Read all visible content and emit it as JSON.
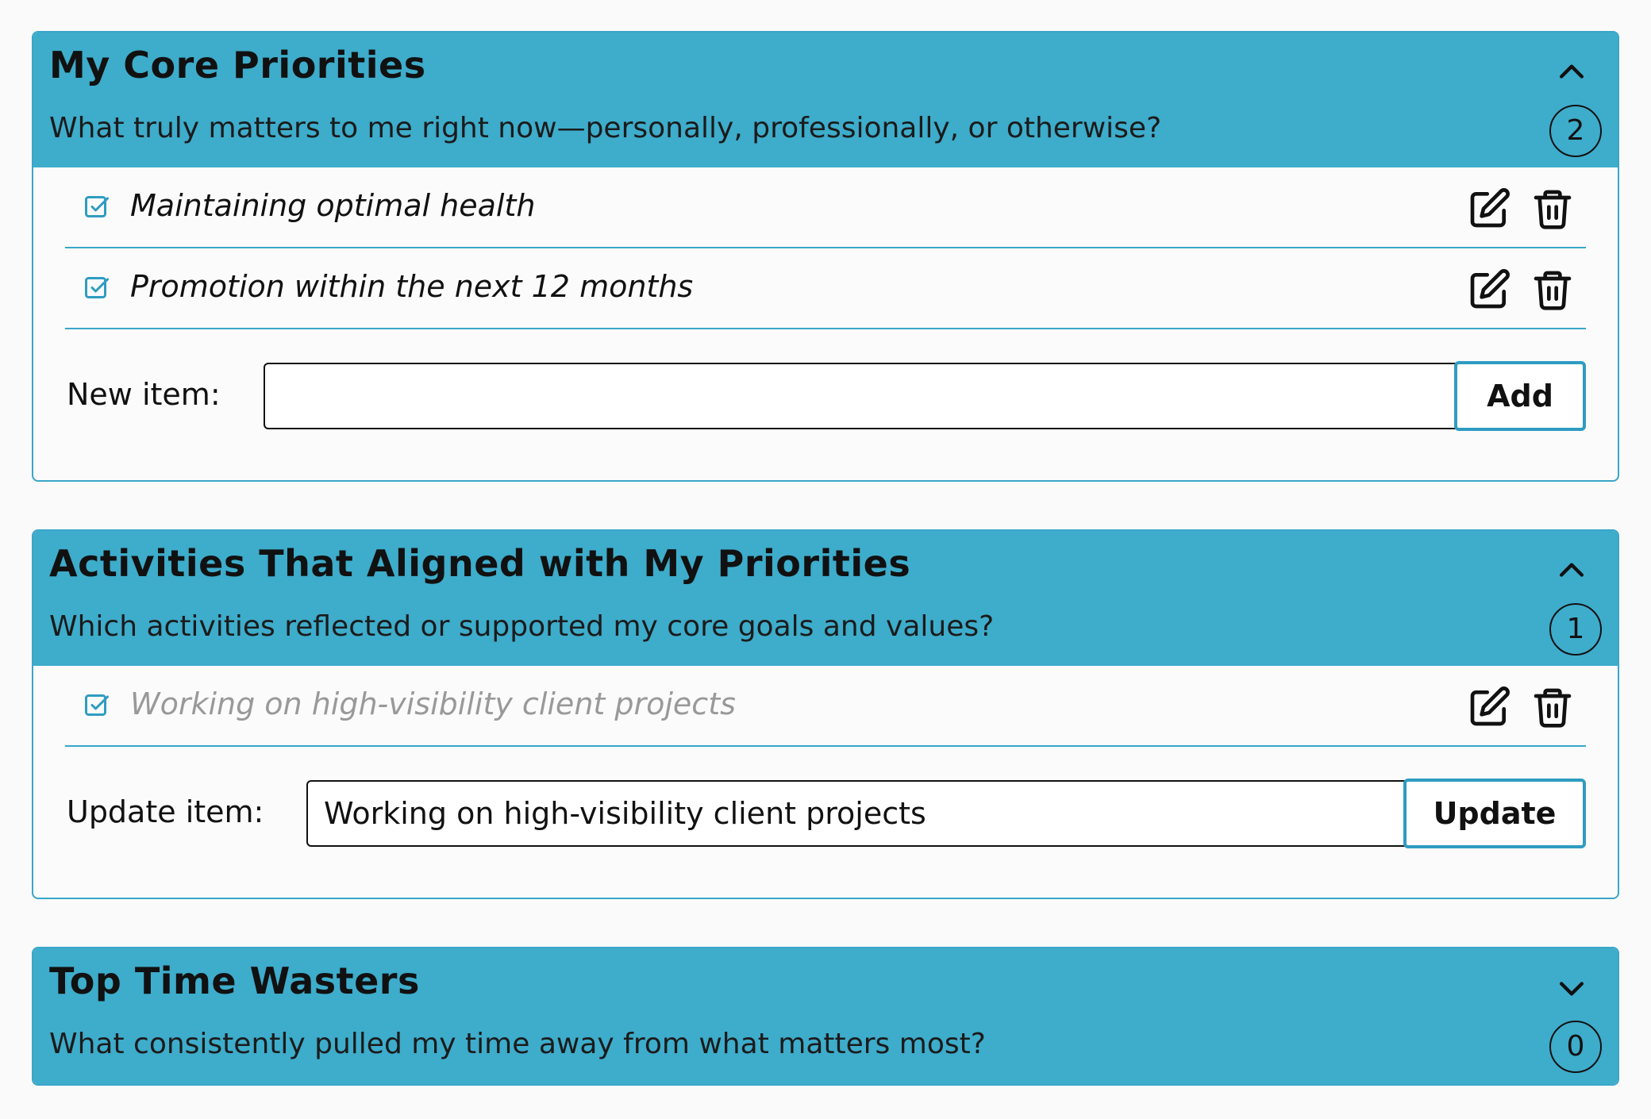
{
  "sections": [
    {
      "title": "My Core Priorities",
      "subtitle": "What truly matters to me right now—personally, professionally, or otherwise?",
      "count": "2",
      "expanded": true,
      "items": [
        {
          "text": "Maintaining optimal health",
          "muted": false
        },
        {
          "text": "Promotion within the next 12 months",
          "muted": false
        }
      ],
      "entry": {
        "label": "New item:",
        "value": "",
        "button": "Add"
      }
    },
    {
      "title": "Activities That Aligned with My Priorities",
      "subtitle": "Which activities reflected or supported my core goals and values?",
      "count": "1",
      "expanded": true,
      "items": [
        {
          "text": "Working on high-visibility client projects",
          "muted": true
        }
      ],
      "entry": {
        "label": "Update item:",
        "value": "Working on high-visibility client projects",
        "button": "Update"
      }
    },
    {
      "title": "Top Time Wasters",
      "subtitle": "What consistently pulled my time away from what matters most?",
      "count": "0",
      "expanded": false
    }
  ],
  "icons": {
    "expanded": "chevron-up-icon",
    "collapsed": "chevron-down-icon",
    "check": "checkbox-checked-icon",
    "edit": "edit-icon",
    "delete": "trash-icon"
  },
  "colors": {
    "header_bg": "#3eaccb",
    "accent": "#3aa6c9",
    "page_bg": "#fafafa",
    "muted_text": "#999999"
  }
}
